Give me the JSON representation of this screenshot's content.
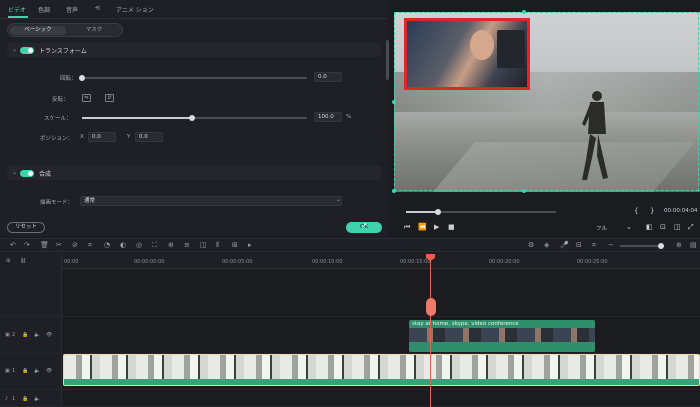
{
  "top_tabs": [
    "ビデオ",
    "色調",
    "音声",
    "⟲",
    "アニメ ション"
  ],
  "segments": [
    "ベーシック",
    "マスク"
  ],
  "transform": {
    "title": "トランスフォーム",
    "rotate_label": "回転：",
    "rotate_value": "0.0",
    "flip_label": "反転：",
    "flip_h": "⇋",
    "flip_v": "⇵",
    "scale_label": "スケール：",
    "scale_value": "100.0",
    "scale_unit": "%",
    "scale_level_percent": 100,
    "position_label": "ポジション：",
    "x_label": "X",
    "x_value": "0.0",
    "y_label": "Y",
    "y_value": "0.0"
  },
  "composite": {
    "title": "合成",
    "blend_label": "描画モード：",
    "blend_value": "通常"
  },
  "buttons": {
    "reset": "リセット",
    "ok": "OK"
  },
  "player": {
    "time": "00:00:04:04",
    "quality": "フル",
    "bracket_left": "{",
    "bracket_right": "}"
  },
  "ruler": [
    "00:00",
    "00:00:00:00",
    "00:00:05:00",
    "00:00:10:00",
    "00:00:15:00",
    "00:00:20:00",
    "00:00:25:00"
  ],
  "tracks": {
    "track2_label": "2",
    "track1_label": "1",
    "audio_label": "1"
  },
  "clip2_title": "stay at home, skype, video conference",
  "accent": "#3fd2ad",
  "pip_border": "#e0242a"
}
